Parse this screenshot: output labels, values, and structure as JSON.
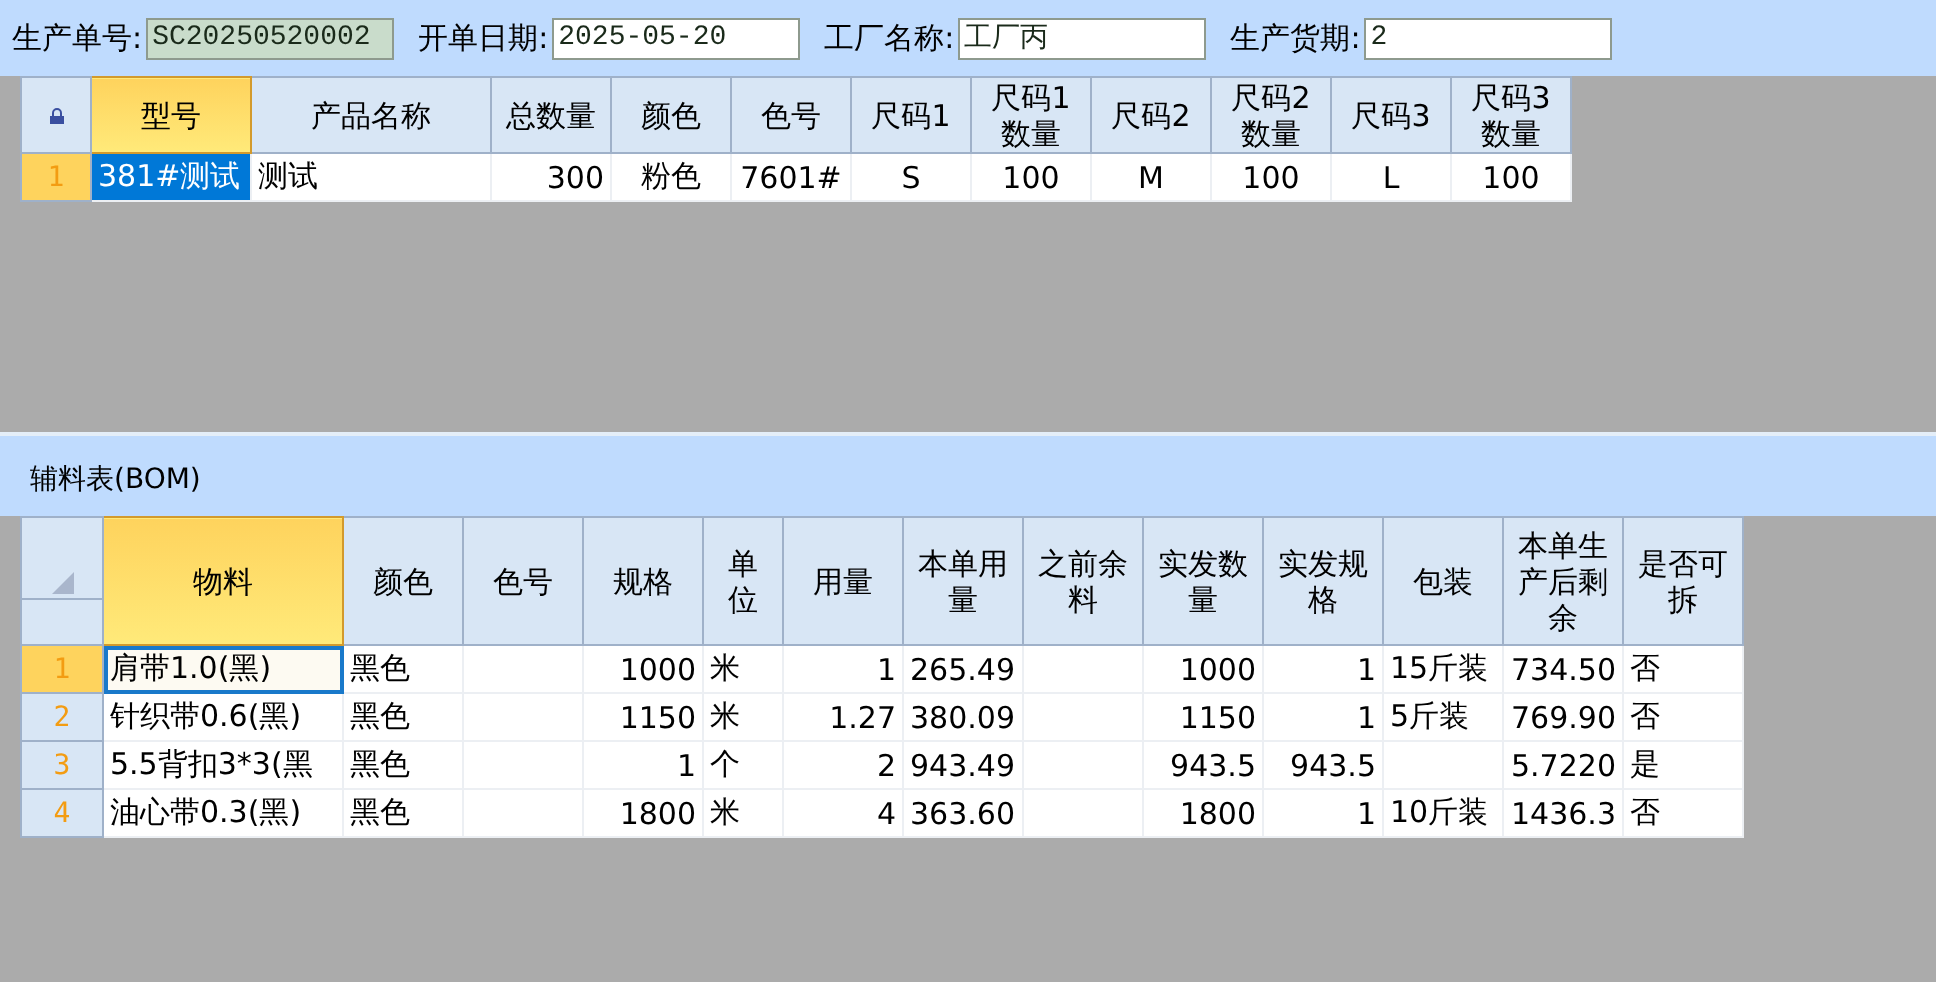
{
  "form": [
    {
      "label": "生产单号:",
      "value": "SC20250520002",
      "disabled": true
    },
    {
      "label": "开单日期:",
      "value": "2025-05-20",
      "disabled": false
    },
    {
      "label": "工厂名称:",
      "value": "工厂丙",
      "disabled": false
    },
    {
      "label": "生产货期:",
      "value": "2",
      "disabled": false
    }
  ],
  "product_table": {
    "corner": {
      "kind": "lock"
    },
    "kind": "entry",
    "columns": [
      {
        "label": "型号",
        "selected": true,
        "kind": "text"
      },
      {
        "label": "产品名称",
        "selected": false,
        "kind": "text"
      },
      {
        "label": "总数量",
        "selected": false,
        "kind": "number"
      },
      {
        "label": "颜色",
        "selected": false,
        "kind": "code"
      },
      {
        "label": "色号",
        "selected": false,
        "kind": "code"
      },
      {
        "label": "尺码1",
        "selected": false,
        "kind": "code"
      },
      {
        "label": "尺码1数量",
        "selected": false,
        "kind": "code"
      },
      {
        "label": "尺码2",
        "selected": false,
        "kind": "code"
      },
      {
        "label": "尺码2数量",
        "selected": false,
        "kind": "code"
      },
      {
        "label": "尺码3",
        "selected": false,
        "kind": "code"
      },
      {
        "label": "尺码3数量",
        "selected": false,
        "kind": "code"
      }
    ],
    "rows": [
      {
        "number": "1",
        "selected": true,
        "cells": [
          "381#测试",
          "测试",
          "300",
          "粉色",
          "7601#",
          "S",
          "100",
          "M",
          "100",
          "L",
          "100"
        ]
      }
    ]
  },
  "bom": {
    "title": "辅料表(BOM)",
    "table": {
      "corner": {
        "kind": "sort"
      },
      "kind": "list",
      "columns": [
        {
          "label": "物料",
          "selected": true,
          "kind": "text"
        },
        {
          "label": "颜色",
          "selected": false,
          "kind": "text"
        },
        {
          "label": "色号",
          "selected": false,
          "kind": "text"
        },
        {
          "label": "规格",
          "selected": false,
          "kind": "number"
        },
        {
          "label": "单位",
          "selected": false,
          "kind": "text"
        },
        {
          "label": "用量",
          "selected": false,
          "kind": "number"
        },
        {
          "label": "本单用量",
          "selected": false,
          "kind": "text"
        },
        {
          "label": "之前余料",
          "selected": false,
          "kind": "number"
        },
        {
          "label": "实发数量",
          "selected": false,
          "kind": "number"
        },
        {
          "label": "实发规格",
          "selected": false,
          "kind": "number"
        },
        {
          "label": "包装",
          "selected": false,
          "kind": "text"
        },
        {
          "label": "本单生产后剩余",
          "selected": false,
          "kind": "number"
        },
        {
          "label": "是否可拆",
          "selected": false,
          "kind": "text"
        }
      ],
      "rows": [
        {
          "number": "1",
          "selected": true,
          "cells": [
            "肩带1.0(黑)",
            "黑色",
            "",
            "1000",
            "米",
            "1",
            "265.49",
            "",
            "1000",
            "1",
            "15斤装",
            "734.50",
            "否"
          ]
        },
        {
          "number": "2",
          "selected": false,
          "cells": [
            "针织带0.6(黑)",
            "黑色",
            "",
            "1150",
            "米",
            "1.27",
            "380.09",
            "",
            "1150",
            "1",
            "5斤装",
            "769.90",
            "否"
          ]
        },
        {
          "number": "3",
          "selected": false,
          "cells": [
            "5.5背扣3*3(黑",
            "黑色",
            "",
            "1",
            "个",
            "2",
            "943.49",
            "",
            "943.5",
            "943.5",
            "",
            "5.7220",
            "是"
          ]
        },
        {
          "number": "4",
          "selected": false,
          "cells": [
            "油心带0.3(黑)",
            "黑色",
            "",
            "1800",
            "米",
            "4",
            "363.60",
            "",
            "1800",
            "1",
            "10斤装",
            "1436.3",
            "否"
          ]
        }
      ]
    }
  }
}
